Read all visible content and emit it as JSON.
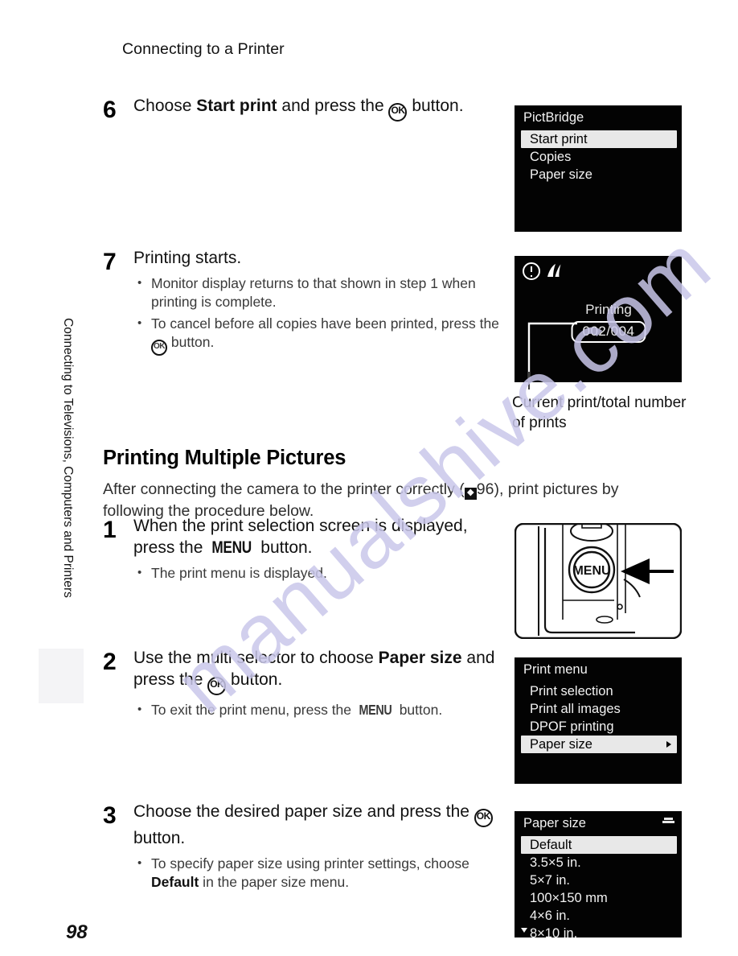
{
  "page": {
    "running_head": "Connecting to a Printer",
    "page_number": "98",
    "side_tab_text": "Connecting to Televisions, Computers and Printers",
    "watermark": "manualshive.com"
  },
  "steps": [
    {
      "number": "6",
      "title_parts": [
        "Choose ",
        "Start print",
        " and press the ",
        "OK",
        " button."
      ],
      "title_plain": "Choose Start print and press the OK button.",
      "bullets": []
    },
    {
      "number": "7",
      "title_plain": "Printing starts.",
      "bullets": [
        "Monitor display returns to that shown in step 1 when printing is complete.",
        "To cancel before all copies have been printed, press the OK button."
      ]
    },
    {
      "number": "1",
      "title_plain": "When the print selection screen is displayed, press the MENU button.",
      "bullets": [
        "The print menu is displayed."
      ]
    },
    {
      "number": "2",
      "title_plain": "Use the multi selector to choose Paper size and press the OK button.",
      "bullets": [
        "To exit the print menu, press the MENU button."
      ]
    },
    {
      "number": "3",
      "title_plain": "Choose the desired paper size and press the OK button.",
      "bullets": [
        "To specify paper size using printer settings, choose Default in the paper size menu."
      ]
    }
  ],
  "step6": {
    "lead": "Choose ",
    "bold": "Start print",
    "mid": " and press the ",
    "ok": "OK",
    "tail": " button."
  },
  "step7": {
    "title": "Printing starts.",
    "bullet1": "Monitor display returns to that shown in step 1 when printing is complete.",
    "bullet2_pre": "To cancel before all copies have been printed, press the ",
    "bullet2_ok": "OK",
    "bullet2_post": " button."
  },
  "section": {
    "heading": "Printing Multiple Pictures",
    "intro_pre": "After connecting the camera to the printer correctly (",
    "intro_ref_page": "96",
    "intro_post": "), print pictures by following the procedure below."
  },
  "step1": {
    "title_pre": "When the print selection screen is displayed, press the ",
    "title_menu": "MENU",
    "title_post": " button.",
    "bullet1": "The print menu is displayed."
  },
  "step2": {
    "title_pre": "Use the multi selector to choose ",
    "title_bold": "Paper size",
    "title_mid": " and press the ",
    "title_ok": "OK",
    "title_post": " button.",
    "bullet_pre": "To exit the print menu, press the ",
    "bullet_menu": "MENU",
    "bullet_post": " button."
  },
  "step3": {
    "title_pre": "Choose the desired paper size and press the ",
    "title_ok": "OK",
    "title_post": " button.",
    "bullet_pre": "To specify paper size using printer settings, choose ",
    "bullet_bold": "Default",
    "bullet_post": " in the paper size menu."
  },
  "screens": {
    "pictbridge": {
      "title": "PictBridge",
      "items": [
        {
          "label": "Start print",
          "selected": true
        },
        {
          "label": "Copies",
          "selected": false
        },
        {
          "label": "Paper size",
          "selected": false
        }
      ]
    },
    "printing": {
      "status_label": "Printing",
      "counter": "002/004",
      "icons": [
        "exclamation-icon",
        "printer-status-icon"
      ],
      "caption": "Current print/total number of prints"
    },
    "print_menu": {
      "title": "Print menu",
      "items": [
        {
          "label": "Print selection",
          "selected": false
        },
        {
          "label": "Print all images",
          "selected": false
        },
        {
          "label": "DPOF printing",
          "selected": false
        },
        {
          "label": "Paper size",
          "selected": true,
          "submenu_arrow": true
        }
      ]
    },
    "paper_size": {
      "title": "Paper size",
      "items": [
        {
          "label": "Default",
          "selected": true
        },
        {
          "label": "3.5×5 in.",
          "selected": false
        },
        {
          "label": "5×7 in.",
          "selected": false
        },
        {
          "label": "100×150 mm",
          "selected": false
        },
        {
          "label": "4×6 in.",
          "selected": false
        },
        {
          "label": "8×10 in.",
          "selected": false
        }
      ],
      "has_scroll_down": true
    }
  },
  "camera_figure": {
    "button_label": "MENU",
    "arrow": "left-pointing-arrow"
  },
  "colors": {
    "lcd_background": "#030303",
    "lcd_text": "#f2f2f2",
    "highlight_background": "#e8e8e8",
    "highlight_text": "#000000",
    "watermark": "#c9c7ea"
  }
}
